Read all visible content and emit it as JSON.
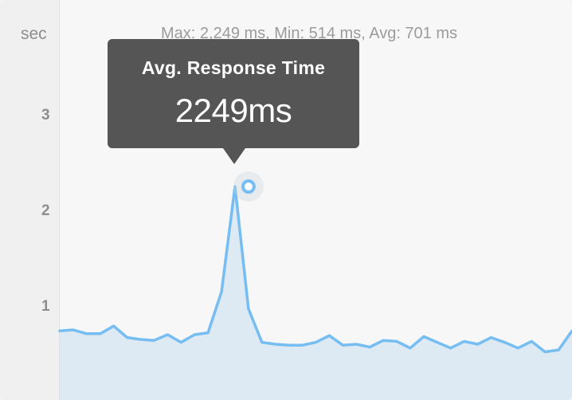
{
  "unit_label": "sec",
  "stats_text": "Max: 2,249 ms, Min: 514 ms, Avg: 701 ms",
  "y_ticks": [
    "3",
    "2",
    "1"
  ],
  "tooltip": {
    "title": "Avg. Response Time",
    "value": "2249ms"
  },
  "colors": {
    "line": "#76bdf2",
    "fill": "#dde9f3",
    "tooltip_bg": "#555555"
  },
  "chart_data": {
    "type": "area",
    "ylabel": "sec",
    "ylim": [
      0,
      3.5
    ],
    "yticks": [
      1,
      2,
      3
    ],
    "grid": false,
    "legend": "none",
    "highlighted_point": {
      "index": 14,
      "value": 2.249
    },
    "series": [
      {
        "values": [
          0.74,
          0.75,
          0.71,
          0.71,
          0.79,
          0.67,
          0.65,
          0.64,
          0.7,
          0.62,
          0.7,
          0.72,
          1.15,
          2.249,
          0.97,
          0.62,
          0.6,
          0.59,
          0.59,
          0.62,
          0.69,
          0.59,
          0.6,
          0.57,
          0.64,
          0.63,
          0.56,
          0.68,
          0.62,
          0.56,
          0.63,
          0.6,
          0.67,
          0.62,
          0.56,
          0.63,
          0.52,
          0.54,
          0.74
        ]
      }
    ]
  }
}
